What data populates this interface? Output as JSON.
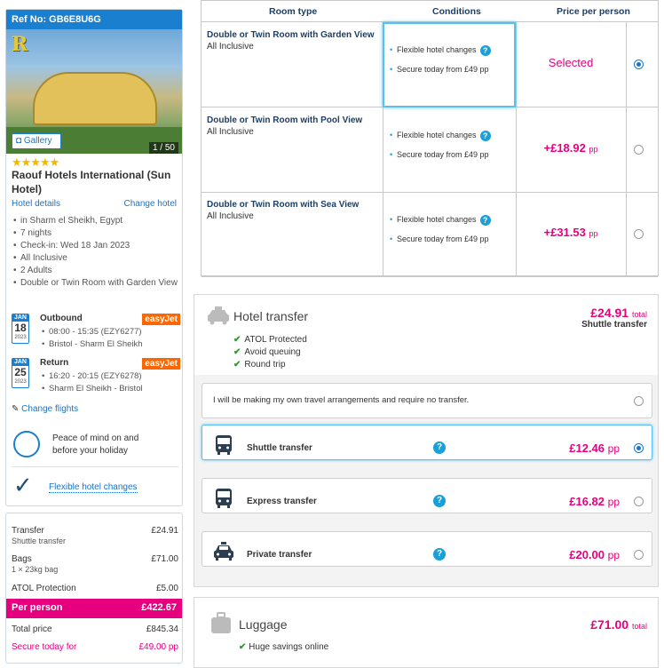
{
  "booking": {
    "ref_label": "Ref No: GB6E8U6G"
  },
  "hotel": {
    "gallery_label": "Gallery",
    "photo_count": "1 / 50",
    "stars": "★★★★★",
    "name": "Raouf Hotels International (Sun Hotel)",
    "details_link": "Hotel details",
    "change_link": "Change hotel",
    "facts": [
      "in Sharm el Sheikh, Egypt",
      "7 nights",
      "Check-in: Wed 18 Jan 2023",
      "All Inclusive",
      "2 Adults",
      "Double or Twin Room with Garden View"
    ]
  },
  "flights": {
    "outbound": {
      "month": "JAN",
      "day": "18",
      "year": "2023",
      "title": "Outbound",
      "airline": "easyJet",
      "time": "08:00 - 15:35 (EZY6277)",
      "route": "Bristol - Sharm El Sheikh"
    },
    "return": {
      "month": "JAN",
      "day": "25",
      "year": "2023",
      "title": "Return",
      "airline": "easyJet",
      "time": "16:20 - 20:15 (EZY6278)",
      "route": "Sharm El Sheikh - Bristol"
    },
    "change_label": "Change flights"
  },
  "atol": {
    "line1": "Peace of mind on and",
    "line2": "before your holiday"
  },
  "flex": {
    "label": "Flexible hotel changes"
  },
  "price_summary": {
    "transfer_label": "Transfer",
    "transfer_sub": "Shuttle transfer",
    "transfer_value": "£24.91",
    "bags_label": "Bags",
    "bags_sub": "1 × 23kg bag",
    "bags_value": "£71.00",
    "atol_label": "ATOL Protection",
    "atol_value": "£5.00",
    "per_person_label": "Per person",
    "per_person_value": "£422.67",
    "total_label": "Total price",
    "total_value": "£845.34",
    "secure_label": "Secure today for",
    "secure_value": "£49.00 pp"
  },
  "rooms": {
    "headers": {
      "room_type": "Room type",
      "conditions": "Conditions",
      "price": "Price per person"
    },
    "items": [
      {
        "name": "Double or Twin Room with Garden View",
        "board": "All Inclusive",
        "cond1": "Flexible hotel changes",
        "cond2": "Secure today from £49 pp",
        "price": "Selected",
        "unit": ""
      },
      {
        "name": "Double or Twin Room with Pool View",
        "board": "All Inclusive",
        "cond1": "Flexible hotel changes",
        "cond2": "Secure today from £49 pp",
        "price": "+£18.92",
        "unit": "pp"
      },
      {
        "name": "Double or Twin Room with Sea View",
        "board": "All Inclusive",
        "cond1": "Flexible hotel changes",
        "cond2": "Secure today from £49 pp",
        "price": "+£31.53",
        "unit": "pp"
      }
    ],
    "selected_index": 0
  },
  "transfer": {
    "title": "Hotel transfer",
    "total_value": "£24.91",
    "total_unit": "total",
    "total_sub": "Shuttle transfer",
    "features": [
      "ATOL Protected",
      "Avoid queuing",
      "Round trip"
    ],
    "own_arrangements": "I will be making my own travel arrangements and require no transfer.",
    "options": [
      {
        "name": "Shuttle transfer",
        "price": "£12.46",
        "unit": "pp",
        "icon": "bus-icon"
      },
      {
        "name": "Express transfer",
        "price": "£16.82",
        "unit": "pp",
        "icon": "bus-icon"
      },
      {
        "name": "Private transfer",
        "price": "£20.00",
        "unit": "pp",
        "icon": "taxi-icon"
      }
    ],
    "selected": "Shuttle transfer"
  },
  "luggage": {
    "title": "Luggage",
    "value": "£71.00",
    "unit": "total",
    "feature": "Huge savings online"
  },
  "colors": {
    "accent": "#1b7fd0",
    "price": "#e6007e",
    "selected_border": "#5bc0eb",
    "tick": "#2a9d2a"
  }
}
